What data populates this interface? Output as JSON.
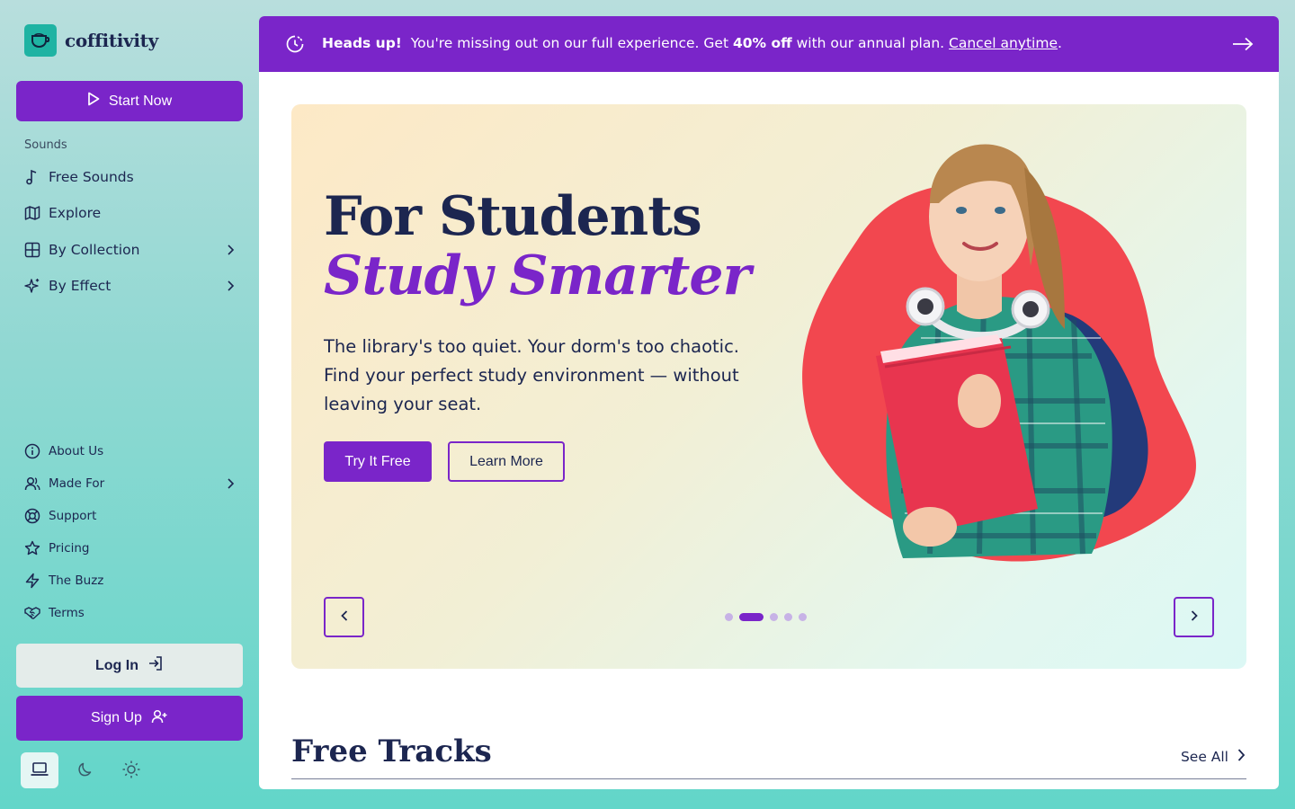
{
  "brand": {
    "name": "coffitivity"
  },
  "sidebar": {
    "start_label": "Start Now",
    "section_label": "Sounds",
    "primary_items": [
      {
        "label": "Free Sounds",
        "icon": "music-note-icon"
      },
      {
        "label": "Explore",
        "icon": "map-icon"
      },
      {
        "label": "By Collection",
        "icon": "grid-icon"
      },
      {
        "label": "By Effect",
        "icon": "sparkle-icon"
      }
    ],
    "secondary_items": [
      {
        "label": "About Us",
        "icon": "info-icon"
      },
      {
        "label": "Made For",
        "icon": "users-icon"
      },
      {
        "label": "Support",
        "icon": "lifebuoy-icon"
      },
      {
        "label": "Pricing",
        "icon": "star-icon"
      },
      {
        "label": "The Buzz",
        "icon": "lightning-icon"
      },
      {
        "label": "Terms",
        "icon": "handshake-icon"
      }
    ],
    "login_label": "Log In",
    "signup_label": "Sign Up",
    "theme_modes": [
      "laptop-icon",
      "moon-icon",
      "sun-icon"
    ],
    "active_theme": "laptop-icon"
  },
  "banner": {
    "heading": "Heads up!",
    "text_before": "You're missing out on our full experience. Get ",
    "discount": "40% off",
    "text_after": " with our annual plan. ",
    "link": "Cancel anytime",
    "period": "."
  },
  "hero": {
    "title_line1": "For Students",
    "title_line2": "Study Smarter",
    "description": "The library's too quiet. Your dorm's too chaotic. Find your perfect study environment — without leaving your seat.",
    "primary_cta": "Try It Free",
    "secondary_cta": "Learn More",
    "slide_count": 5,
    "active_slide": 2
  },
  "free_tracks": {
    "title": "Free Tracks",
    "see_all": "See All"
  },
  "colors": {
    "brand": "#7a25c9",
    "ink": "#1c2650",
    "accent_teal": "#1fb3a3",
    "blob": "#f2474f"
  }
}
